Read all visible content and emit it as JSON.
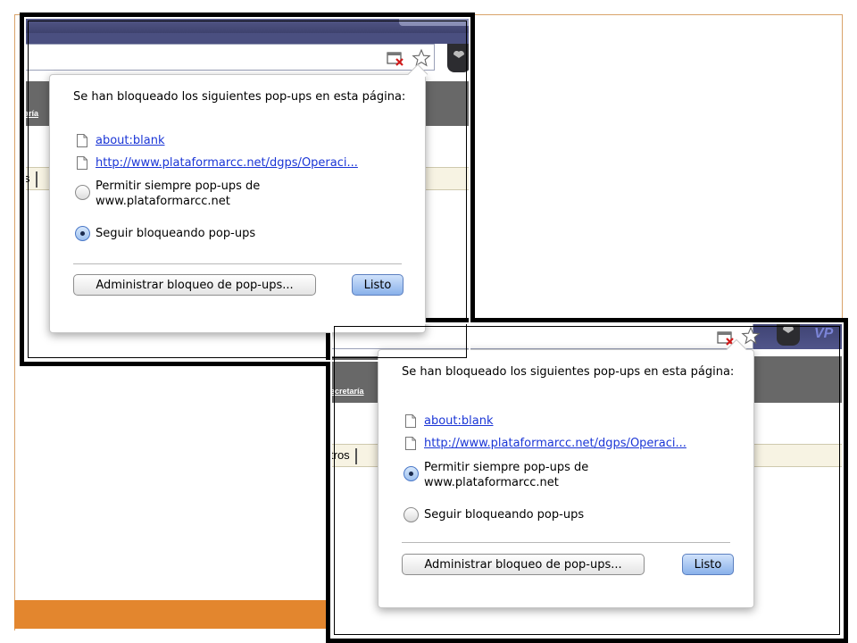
{
  "colors": {
    "accent_orange": "#e3862e",
    "link_blue": "#1a35d6",
    "nav_gray": "#686868",
    "browser_purple": "#4a4f80"
  },
  "panels": [
    {
      "nav_link": "aría",
      "tab_label": "s",
      "bubble": {
        "title": "Se han bloqueado los siguientes pop-ups en esta página:",
        "links": [
          "about:blank",
          "http://www.plataformarcc.net/dgps/Operaci..."
        ],
        "option_allow": "Permitir siempre pop-ups de www.plataformarcc.net",
        "option_block": "Seguir bloqueando pop-ups",
        "selected": "block",
        "manage_button": "Administrar bloqueo de pop-ups...",
        "done_button": "Listo"
      }
    },
    {
      "nav_link": "ecretaría",
      "tab_label": "tros",
      "vp_text": "VP",
      "bubble": {
        "title": "Se han bloqueado los siguientes pop-ups en esta página:",
        "links": [
          "about:blank",
          "http://www.plataformarcc.net/dgps/Operaci..."
        ],
        "option_allow": "Permitir siempre pop-ups de www.plataformarcc.net",
        "option_block": "Seguir bloqueando pop-ups",
        "selected": "allow",
        "manage_button": "Administrar bloqueo de pop-ups...",
        "done_button": "Listo"
      }
    }
  ],
  "icons": [
    "popup-blocked-icon",
    "star-icon",
    "document-icon",
    "extension-icon"
  ]
}
